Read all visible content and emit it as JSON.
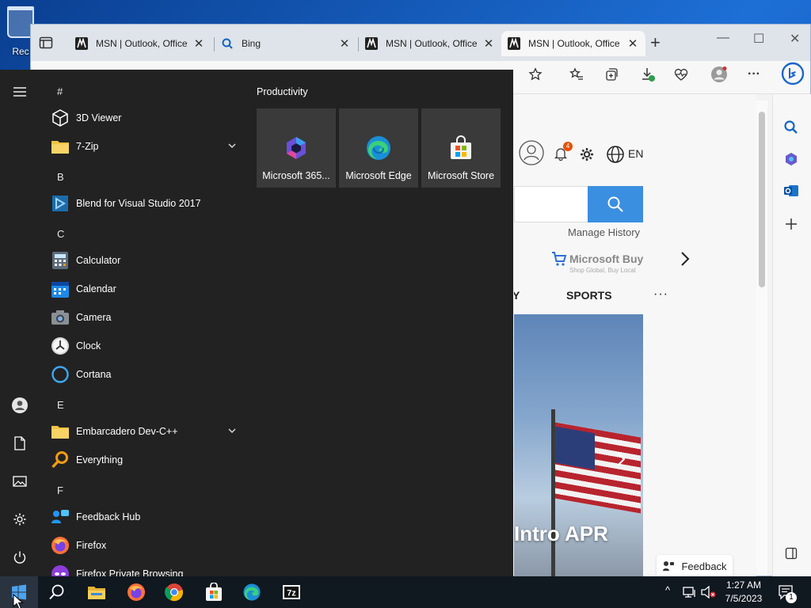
{
  "desktop": {
    "recycle_bin_label": "Rec"
  },
  "browser": {
    "tabs": [
      {
        "label": "MSN | Outlook, Office",
        "favicon": "msn-icon",
        "close": "✕"
      },
      {
        "label": "Bing",
        "favicon": "search-icon",
        "close": "✕"
      },
      {
        "label": "MSN | Outlook, Office",
        "favicon": "msn-icon",
        "close": "✕"
      },
      {
        "label": "MSN | Outlook, Office",
        "favicon": "msn-icon",
        "close": "✕",
        "active": true
      }
    ],
    "new_tab": "+",
    "window_controls": {
      "minimize": "—",
      "maximize": "☐",
      "close": "✕"
    },
    "toolbar": {
      "more": "···"
    }
  },
  "msn": {
    "language": "EN",
    "notification_count": "4",
    "manage_history": "Manage History",
    "buy_label": "Microsoft Buy",
    "buy_sub": "Shop Global, Buy Local",
    "nav_partial": "Y",
    "nav_sports": "SPORTS",
    "nav_more": "···",
    "hero_title": "Intro APR",
    "feedback": "Feedback"
  },
  "start_menu": {
    "letters": {
      "hash": "#",
      "b": "B",
      "c": "C",
      "e": "E",
      "f": "F"
    },
    "apps": {
      "viewer3d": "3D Viewer",
      "sevenzip": "7-Zip",
      "blend": "Blend for Visual Studio 2017",
      "calculator": "Calculator",
      "calendar": "Calendar",
      "camera": "Camera",
      "clock": "Clock",
      "cortana": "Cortana",
      "embarcadero": "Embarcadero Dev-C++",
      "everything": "Everything",
      "feedback_hub": "Feedback Hub",
      "firefox": "Firefox",
      "firefox_private": "Firefox Private Browsing"
    },
    "tiles_group": "Productivity",
    "tiles": {
      "m365": "Microsoft 365...",
      "edge": "Microsoft Edge",
      "store": "Microsoft Store"
    }
  },
  "taskbar": {
    "time": "1:27 AM",
    "date": "7/5/2023",
    "notification_count": "1",
    "tray_chevron": "^"
  },
  "colors": {
    "start_bg": "#222222",
    "tile_bg": "#3a3a3a",
    "accent_blue": "#3a8fe0",
    "taskbar_bg": "#101820"
  }
}
